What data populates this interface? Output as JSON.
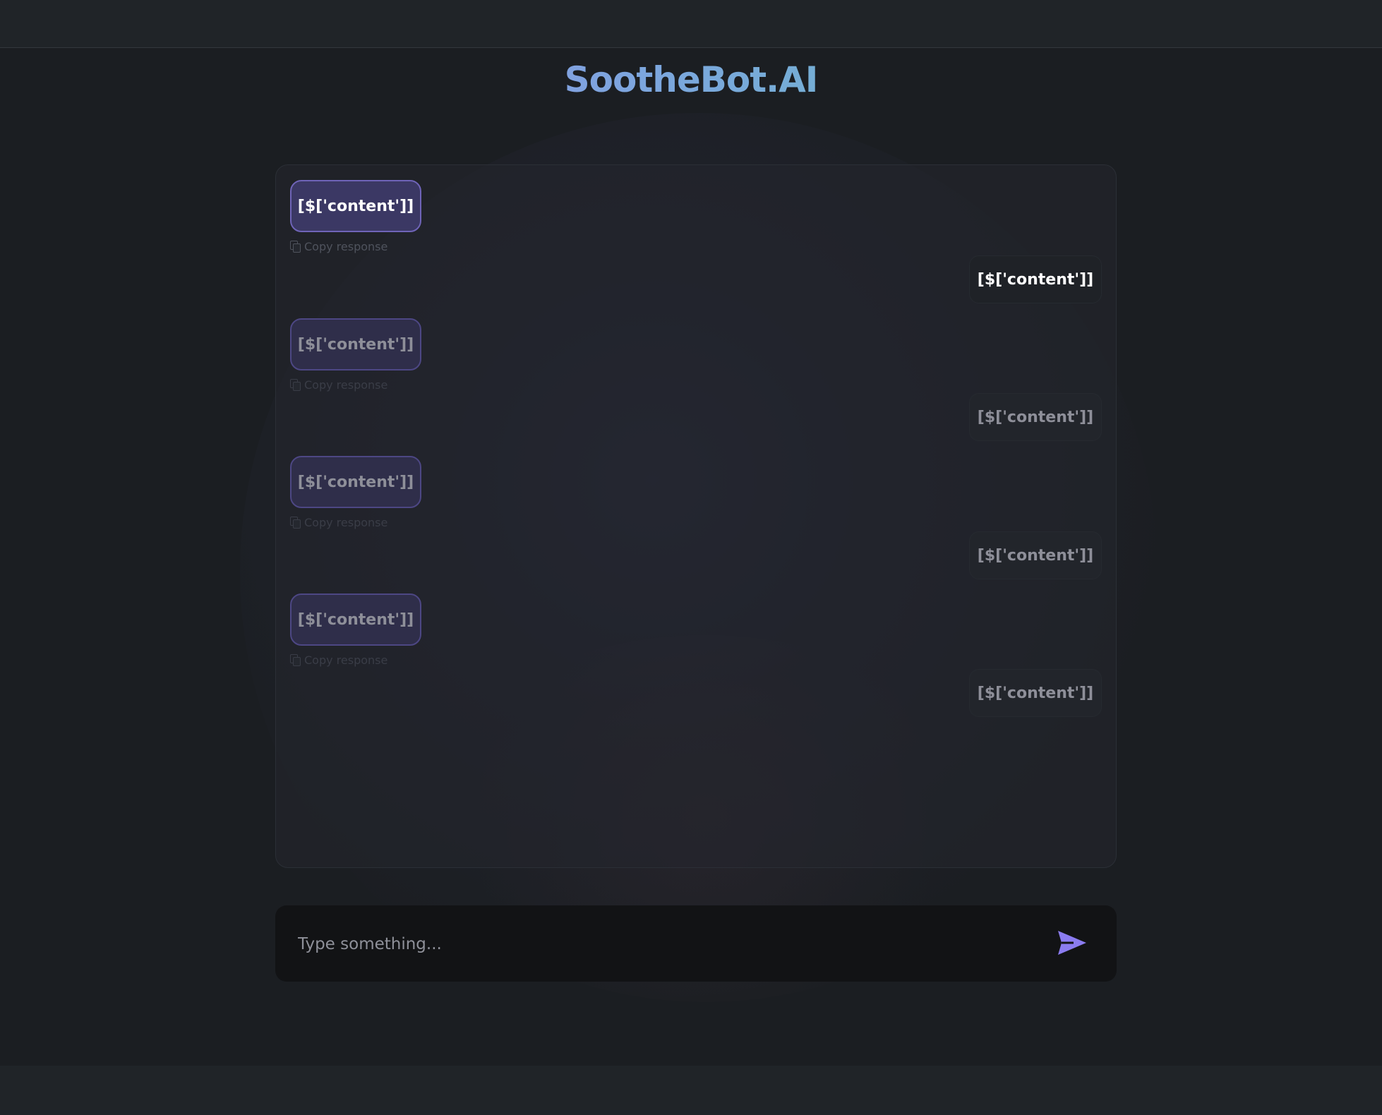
{
  "app": {
    "title": "SootheBot.AI"
  },
  "colors": {
    "brand_gradient_start": "#9c86ee",
    "brand_gradient_mid": "#7aa8dc",
    "brand_gradient_end": "#5fc6b6",
    "accent": "#8b7cf0",
    "background": "#1b1e22"
  },
  "chat": {
    "copy_label": "Copy response",
    "messages": [
      {
        "role": "bot",
        "content": "[$['content']]",
        "copy_label": "Copy response"
      },
      {
        "role": "user",
        "content": "[$['content']]"
      },
      {
        "role": "bot",
        "content": "[$['content']]",
        "copy_label": "Copy response"
      },
      {
        "role": "user",
        "content": "[$['content']]"
      },
      {
        "role": "bot",
        "content": "[$['content']]",
        "copy_label": "Copy response"
      },
      {
        "role": "user",
        "content": "[$['content']]"
      },
      {
        "role": "bot",
        "content": "[$['content']]",
        "copy_label": "Copy response"
      },
      {
        "role": "user",
        "content": "[$['content']]"
      }
    ]
  },
  "input": {
    "placeholder": "Type something...",
    "value": "",
    "send_icon": "send-arrow-icon"
  }
}
